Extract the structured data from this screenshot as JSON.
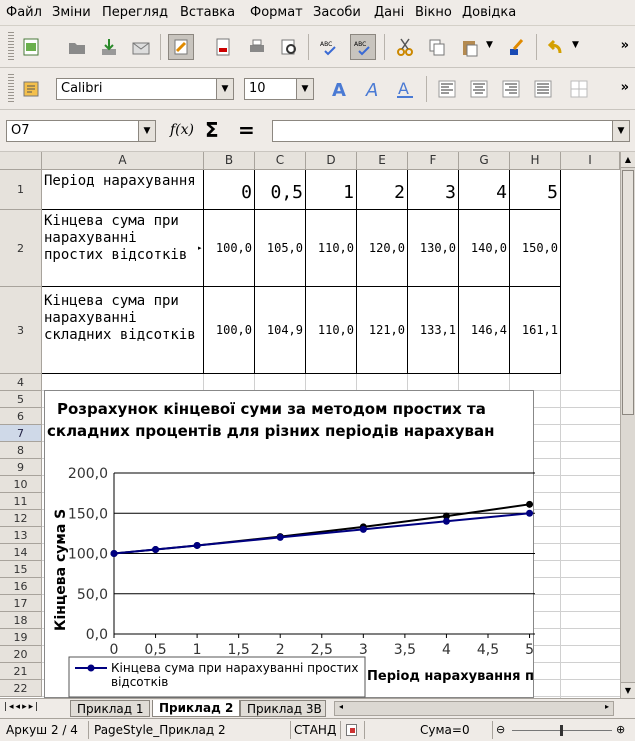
{
  "menu": [
    "Файл",
    "Зміни",
    "Перегляд",
    "Вставка",
    "Формат",
    "Засоби",
    "Дані",
    "Вікно",
    "Довідка"
  ],
  "toolbar": {
    "font_name": "Calibri",
    "font_size": "10"
  },
  "formula_bar": {
    "cell_ref": "O7",
    "content": ""
  },
  "columns": [
    "A",
    "B",
    "C",
    "D",
    "E",
    "F",
    "G",
    "H",
    "I"
  ],
  "rows": [
    "1",
    "2",
    "3",
    "4",
    "5",
    "6",
    "7",
    "8",
    "9",
    "10",
    "11",
    "12",
    "13",
    "14",
    "15",
    "16",
    "17",
    "18",
    "19",
    "20",
    "21",
    "22"
  ],
  "table": {
    "r1": {
      "label": "Період нарахування",
      "values": [
        "0",
        "0,5",
        "1",
        "2",
        "3",
        "4",
        "5"
      ]
    },
    "r2": {
      "label": "Кінцева сума при нарахуванні простих відсотків",
      "values": [
        "100,0",
        "105,0",
        "110,0",
        "120,0",
        "130,0",
        "140,0",
        "150,0"
      ]
    },
    "r3": {
      "label": "Кінцева сума при нарахуванні складних відсотків",
      "values": [
        "100,0",
        "104,9",
        "110,0",
        "121,0",
        "133,1",
        "146,4",
        "161,1"
      ]
    }
  },
  "chart_data": {
    "type": "line",
    "title": "Розрахунок кінцевої суми за методом простих та складних процентів для різних періодів нарахуван",
    "xlabel": "Період нарахування п",
    "ylabel": "Кінцева сума S",
    "xlim": [
      0,
      5
    ],
    "ylim": [
      0,
      200
    ],
    "x_ticks": [
      "0",
      "0,5",
      "1",
      "1,5",
      "2",
      "2,5",
      "3",
      "3,5",
      "4",
      "4,5",
      "5"
    ],
    "y_ticks": [
      "0,0",
      "50,0",
      "100,0",
      "150,0",
      "200,0"
    ],
    "legend_position": "bottom-left",
    "series": [
      {
        "name": "Кінцева сума при нарахуванні простих відсотків",
        "color": "#000080",
        "x": [
          0,
          0.5,
          1,
          2,
          3,
          4,
          5
        ],
        "values": [
          100,
          105,
          110,
          120,
          130,
          140,
          150
        ]
      },
      {
        "color": "#000000",
        "x": [
          0,
          0.5,
          1,
          2,
          3,
          4,
          5
        ],
        "values": [
          100,
          104.9,
          110,
          121,
          133.1,
          146.4,
          161.1
        ]
      }
    ]
  },
  "sheet_tabs": [
    "Приклад 1",
    "Приклад 2",
    "Приклад 3В"
  ],
  "status": {
    "sheet": "Аркуш 2 / 4",
    "page_style": "PageStyle_Приклад 2",
    "mode": "СТАНД",
    "sum": "Сума=0"
  },
  "colors": {
    "selection": "#cfd9e8",
    "simple_series": "#000080",
    "compound_series": "#000000"
  }
}
